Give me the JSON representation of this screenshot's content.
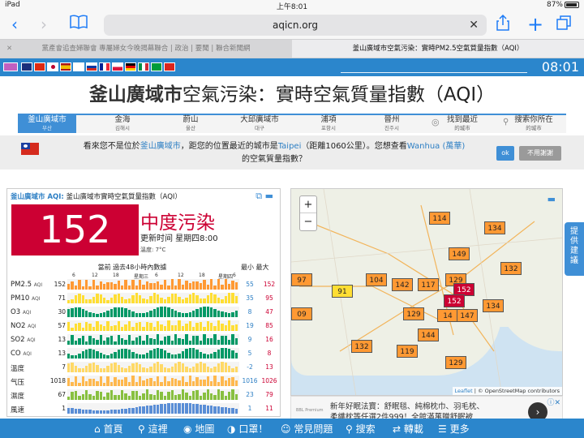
{
  "status_bar": {
    "device": "iPad",
    "time": "上午8:01",
    "battery": "87%"
  },
  "browser": {
    "url": "aqicn.org",
    "tabs": [
      {
        "title": "黨產會追查婦聯會 專屬婦女今晚揭幕聯合 | 政治 | 要聞 | 聯合新聞網"
      },
      {
        "title": "釜山廣域市空氣污染：實時PM2.5空氣質量指數（AQI）"
      }
    ]
  },
  "site": {
    "clock": "08:01",
    "title_bold": "釜山廣域市",
    "title_rest": "空氣污染：實時空氣質量指數（AQI）",
    "nav": [
      {
        "label": "釜山廣域市",
        "sub": "부산"
      },
      {
        "label": "金海",
        "sub": "김해시"
      },
      {
        "label": "蔚山",
        "sub": "울산"
      },
      {
        "label": "大邱廣域市",
        "sub": "대구"
      },
      {
        "label": "浦項",
        "sub": "포항시"
      },
      {
        "label": "晉州",
        "sub": "진주시"
      },
      {
        "label": "找到最近",
        "sub": "的城市"
      },
      {
        "label": "搜索你所在",
        "sub": "的城市"
      }
    ],
    "notice": {
      "p1": "看來您不是位於",
      "city": "釜山廣域市",
      "p2": "，距您的位置最近的城市是",
      "near": "Taipei",
      "p3": "（距離1060公里）。您想查看",
      "station": "Wanhua (萬華)",
      "p4": "的空氣質量指數？",
      "ok": "ok",
      "no": "不用謝謝"
    }
  },
  "widget": {
    "city": "釜山廣域市 AQI:",
    "subtitle": "釜山廣域市實時空氣質量指數（AQI）",
    "aqi": "152",
    "level": "中度污染",
    "updated": "更新时间 星期四8:00",
    "temperature": "溫度: 7°C",
    "history_title": "當前 過去48小時內數據",
    "minmax_label": "最小 最大",
    "axis_labels": [
      "6",
      "12",
      "18",
      "星期三",
      "6",
      "12",
      "18",
      "星期四",
      "6"
    ],
    "rows": [
      {
        "name": "PM2.5",
        "unit": "AQI",
        "current": "152",
        "min": "55",
        "max": "152",
        "color": "#ff9933"
      },
      {
        "name": "PM10",
        "unit": "AQI",
        "current": "71",
        "min": "35",
        "max": "95",
        "color": "#ffde33"
      },
      {
        "name": "O3",
        "unit": "AQI",
        "current": "30",
        "min": "8",
        "max": "47",
        "color": "#009966"
      },
      {
        "name": "NO2",
        "unit": "AQI",
        "current": "57",
        "min": "19",
        "max": "85",
        "color": "#ffde33"
      },
      {
        "name": "SO2",
        "unit": "AQI",
        "current": "13",
        "min": "9",
        "max": "16",
        "color": "#009966"
      },
      {
        "name": "CO",
        "unit": "AQI",
        "current": "13",
        "min": "5",
        "max": "8",
        "color": "#009966"
      },
      {
        "name": "溫度",
        "unit": "",
        "current": "7",
        "min": "-2",
        "max": "13",
        "color": "#ffd966"
      },
      {
        "name": "气压",
        "unit": "",
        "current": "1018",
        "min": "1016",
        "max": "1026",
        "color": "#ffb84d"
      },
      {
        "name": "濕度",
        "unit": "",
        "current": "67",
        "min": "23",
        "max": "79",
        "color": "#88c040"
      },
      {
        "name": "風速",
        "unit": "",
        "current": "1",
        "min": "1",
        "max": "11",
        "color": "#5a8ed6"
      }
    ]
  },
  "map": {
    "zoom_in": "+",
    "zoom_out": "−",
    "attribution_leaflet": "Leaflet",
    "attribution_rest": "| © OpenStreetMap contributors",
    "markers": [
      {
        "value": "114",
        "level": "orange"
      },
      {
        "value": "134",
        "level": "orange"
      },
      {
        "value": "149",
        "level": "orange"
      },
      {
        "value": "132",
        "level": "orange"
      },
      {
        "value": "97",
        "level": "orange"
      },
      {
        "value": "104",
        "level": "orange"
      },
      {
        "value": "91",
        "level": "yellow"
      },
      {
        "value": "142",
        "level": "orange"
      },
      {
        "value": "117",
        "level": "orange"
      },
      {
        "value": "129",
        "level": "orange"
      },
      {
        "value": "152",
        "level": "red"
      },
      {
        "value": "152",
        "level": "red"
      },
      {
        "value": "134",
        "level": "orange"
      },
      {
        "value": "129",
        "level": "orange"
      },
      {
        "value": "14",
        "level": "orange"
      },
      {
        "value": "147",
        "level": "orange"
      },
      {
        "value": "09",
        "level": "orange"
      },
      {
        "value": "144",
        "level": "orange"
      },
      {
        "value": "132",
        "level": "orange"
      },
      {
        "value": "119",
        "level": "orange"
      },
      {
        "value": "129",
        "level": "orange"
      }
    ]
  },
  "ad": {
    "line1": "新年好眠法寶：舒眠毯、純棉枕巾、羽毛枕、",
    "line2": "柔纖枕等任選2件999！全館滿萬贈舒眠被",
    "brand": "BBL Premium"
  },
  "feedback": "提供建議",
  "bottom_bar": [
    "首頁",
    "這裡",
    "地圖",
    "口罩！",
    "常見問題",
    "搜索",
    "轉載",
    "更多"
  ]
}
